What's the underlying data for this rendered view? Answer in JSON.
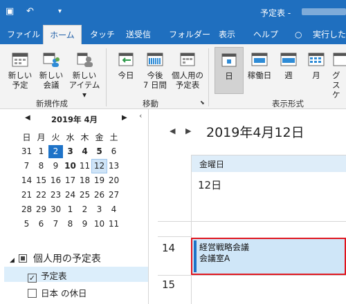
{
  "window": {
    "title": "予定表 -"
  },
  "tabs": [
    "ファイル",
    "ホーム",
    "タッチ",
    "送受信",
    "フォルダー",
    "表示",
    "ヘルプ",
    "実行したい"
  ],
  "ribbon": {
    "new_group": {
      "label": "新規作成",
      "buttons": [
        [
          "新しい",
          "予定"
        ],
        [
          "新しい",
          "会議"
        ],
        [
          "新しい",
          "アイテム ▾"
        ]
      ]
    },
    "move_group": {
      "label": "移動",
      "buttons": [
        [
          "今日",
          ""
        ],
        [
          "今後",
          "7 日間"
        ],
        [
          "個人用の",
          "予定表"
        ]
      ]
    },
    "view_group": {
      "label": "表示形式",
      "buttons": [
        "日",
        "稼働日",
        "週",
        "月",
        "グ",
        "スケ"
      ]
    }
  },
  "mini_calendar": {
    "header": "2019年 4月",
    "weekdays": [
      "日",
      "月",
      "火",
      "水",
      "木",
      "金",
      "土"
    ],
    "weeks": [
      [
        "31",
        "1",
        "2",
        "3",
        "4",
        "5",
        "6"
      ],
      [
        "7",
        "8",
        "9",
        "10",
        "11",
        "12",
        "13"
      ],
      [
        "14",
        "15",
        "16",
        "17",
        "18",
        "19",
        "20"
      ],
      [
        "21",
        "22",
        "23",
        "24",
        "25",
        "26",
        "27"
      ],
      [
        "28",
        "29",
        "30",
        "1",
        "2",
        "3",
        "4"
      ],
      [
        "5",
        "6",
        "7",
        "8",
        "9",
        "10",
        "11"
      ]
    ],
    "bold_days": [
      "3",
      "4",
      "5",
      "10"
    ],
    "selected_day": "2",
    "today": "12"
  },
  "folders": {
    "group_title": "個人用の予定表",
    "items": [
      {
        "label": "予定表",
        "checked": "✓"
      },
      {
        "label": "日本 の休日",
        "checked": ""
      }
    ]
  },
  "view": {
    "date_title": "2019年4月12日",
    "weekday": "金曜日",
    "day_number": "12日",
    "hours": [
      "14",
      "15"
    ]
  },
  "appointment": {
    "title": "経営戦略会議",
    "location": "会議室A"
  },
  "colors": {
    "accent": "#1f6fbf",
    "selected": "#1e73c8",
    "highlight_border": "#e0141e"
  }
}
